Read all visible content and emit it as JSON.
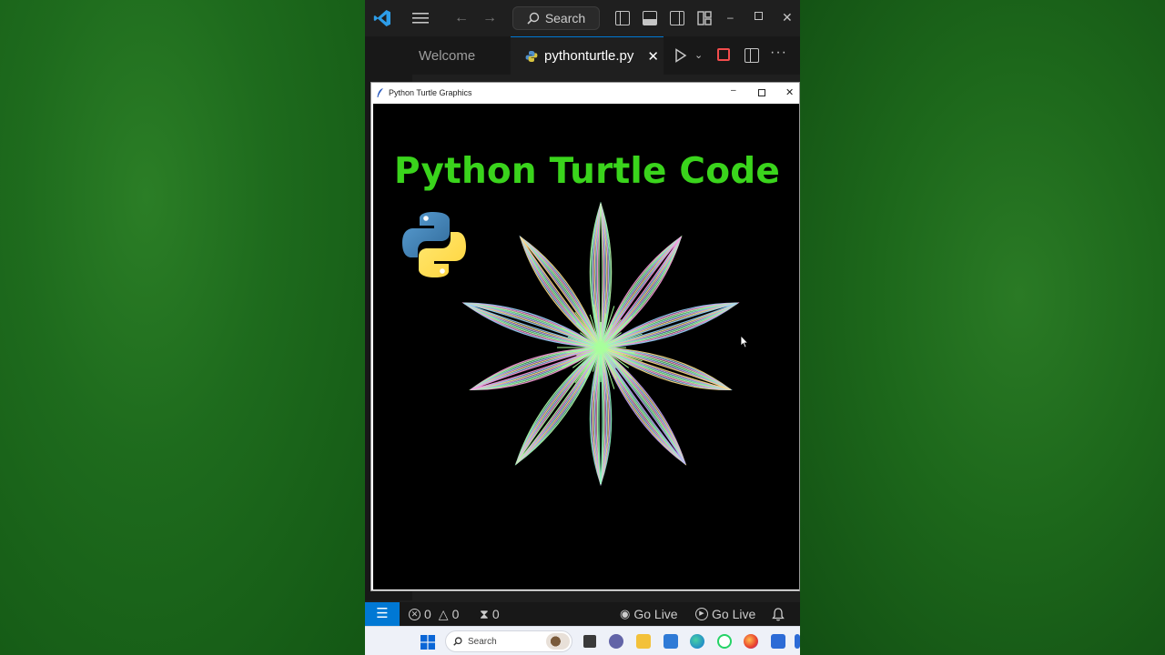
{
  "vscode": {
    "search_label": "Search",
    "tabs": [
      {
        "label": "Welcome",
        "active": false
      },
      {
        "label": "pythonturtle.py",
        "active": true
      }
    ],
    "accent_color": "#0078d4"
  },
  "turtle_window": {
    "title": "Python Turtle Graphics",
    "canvas_heading": "Python Turtle Code",
    "heading_color": "#3ad41c",
    "canvas_background": "#000000"
  },
  "statusbar": {
    "errors": "0",
    "warnings": "0",
    "ports": "0",
    "go_live_1": "Go Live",
    "go_live_2": "Go Live"
  },
  "taskbar": {
    "search_label": "Search"
  },
  "icons": [
    "vscode-logo-icon",
    "menu-icon",
    "back-icon",
    "forward-icon",
    "search-icon",
    "layout-icons",
    "explorer-icon",
    "python-file-icon",
    "close-icon",
    "run-icon",
    "stop-icon",
    "split-icon",
    "more-icon",
    "remote-icon",
    "error-icon",
    "warning-icon",
    "broadcast-icon",
    "bell-icon",
    "windows-start-icon"
  ]
}
